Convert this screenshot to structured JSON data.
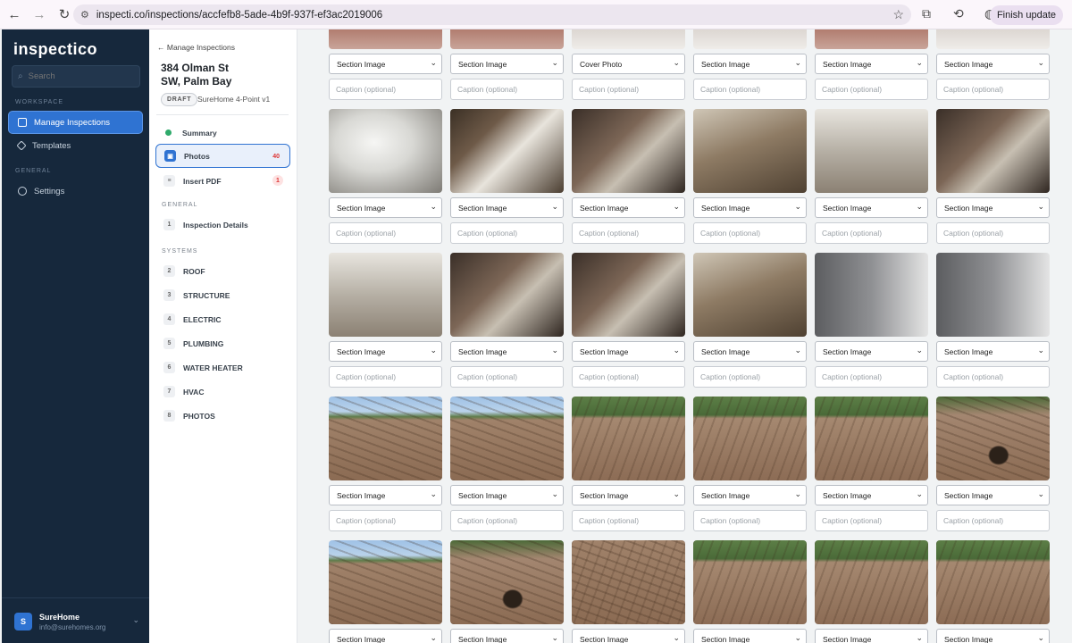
{
  "browser": {
    "url": "inspecti.co/inspections/accfefb8-5ade-4b9f-937f-ef3ac2019006",
    "finish_update": "Finish update"
  },
  "sidebar": {
    "logo": "inspectico",
    "search_placeholder": "Search",
    "workspace_label": "WORKSPACE",
    "general_label": "GENERAL",
    "items": [
      {
        "label": "Manage Inspections",
        "active": true
      },
      {
        "label": "Templates",
        "active": false
      },
      {
        "label": "Settings",
        "active": false
      }
    ],
    "user": {
      "initial": "S",
      "name": "SureHome",
      "email": "info@surehomes.org"
    }
  },
  "panel": {
    "back_link": "← Manage Inspections",
    "address_line1": "384 Olman St",
    "address_line2": "SW, Palm Bay",
    "status": "DRAFT",
    "template": "SureHome 4-Point v1",
    "top_items": [
      {
        "label": "Summary",
        "count": ""
      },
      {
        "label": "Photos",
        "count": "40"
      },
      {
        "label": "Insert PDF",
        "count": "1"
      }
    ],
    "general_label": "GENERAL",
    "general_items": [
      {
        "num": "1",
        "label": "Inspection Details"
      }
    ],
    "systems_label": "SYSTEMS",
    "systems": [
      {
        "num": "2",
        "label": "ROOF"
      },
      {
        "num": "3",
        "label": "STRUCTURE"
      },
      {
        "num": "4",
        "label": "ELECTRIC"
      },
      {
        "num": "5",
        "label": "PLUMBING"
      },
      {
        "num": "6",
        "label": "WATER HEATER"
      },
      {
        "num": "7",
        "label": "HVAC"
      },
      {
        "num": "8",
        "label": "PHOTOS"
      }
    ]
  },
  "grid": {
    "caption_placeholder": "Caption (optional)",
    "rows": [
      {
        "tags": [
          "Section Image",
          "Section Image",
          "Cover Photo",
          "Section Image",
          "Section Image",
          "Section Image"
        ]
      },
      {
        "tags": [
          "Section Image",
          "Section Image",
          "Section Image",
          "Section Image",
          "Section Image",
          "Section Image"
        ]
      },
      {
        "tags": [
          "Section Image",
          "Section Image",
          "Section Image",
          "Section Image",
          "Section Image",
          "Section Image"
        ]
      },
      {
        "tags": [
          "Section Image",
          "Section Image",
          "Section Image",
          "Section Image",
          "Section Image",
          "Section Image"
        ]
      },
      {
        "tags": [
          "Section Image",
          "Section Image",
          "Section Image",
          "Section Image",
          "Section Image",
          "Section Image"
        ]
      }
    ]
  }
}
